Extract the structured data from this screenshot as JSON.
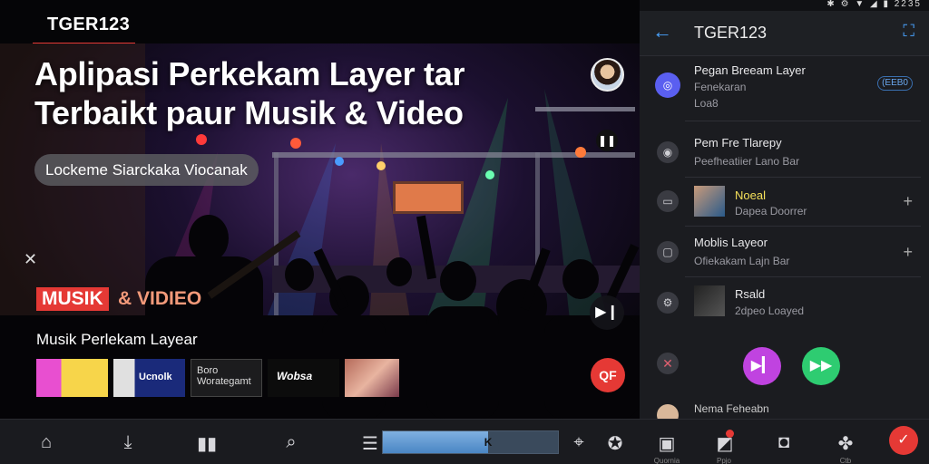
{
  "hero": {
    "brand": "TGER123",
    "headline": "Aplipasi Perkekam Layer tar Terbaikt paur Musik & Video",
    "pill": "Lockeme Siarckaka Viocanak",
    "pause_glyph": "❚❚",
    "close_glyph": "✕",
    "musik_badge": "MUSIK",
    "musik_suffix": "& VIDIEO",
    "section_title": "Musik Perlekam Layear",
    "thumbs": [
      {
        "label": ""
      },
      {
        "label": "Ucnolk"
      },
      {
        "label": "Boro Worategamt"
      },
      {
        "label": "Wobsa"
      },
      {
        "label": ""
      }
    ],
    "play_glyph": "▶❙",
    "red_glyph": "QF"
  },
  "panel": {
    "status_icons": "✱ ⚙ ▼ ◢ ▮ 2235",
    "back_glyph": "←",
    "title": "TGER123",
    "action_glyph": "⛶",
    "rows": [
      {
        "title": "Pegan Breeam Layer",
        "sub1": "Fenekaran",
        "sub2": "Loa8",
        "chip": "(EEB0"
      },
      {
        "title": "Pem Fre Tlarepy",
        "sub": "Peefheatiier Lano Bar"
      },
      {
        "title": "Noeal",
        "sub": "Dapea Doorrer"
      },
      {
        "title": "Moblis Layeor",
        "sub": "Ofiekakam Lajn Bar"
      },
      {
        "title": "Rsald",
        "sub": "2dpeo Loayed"
      }
    ],
    "partial_name": "Nema Feheabn"
  },
  "bottombar": {
    "labels": [
      "Quornia",
      "Ppjo",
      "Ctb"
    ],
    "progress": 0.6
  },
  "colors": {
    "accent_red": "#e53935",
    "accent_blue": "#4aa3ff",
    "purple": "#c043e0",
    "green": "#2ecc71"
  }
}
